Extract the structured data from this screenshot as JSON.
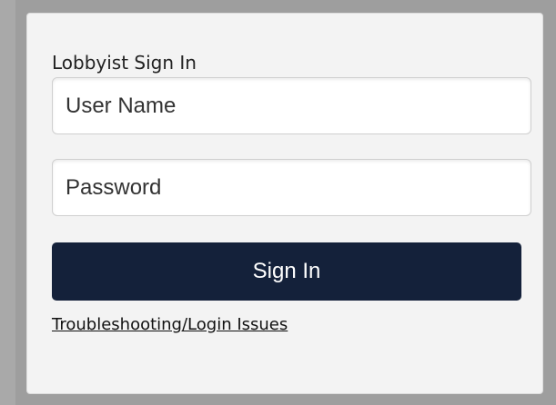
{
  "login": {
    "title": "Lobbyist Sign In",
    "username_placeholder": "User Name",
    "password_placeholder": "Password",
    "submit_label": "Sign In",
    "help_link": "Troubleshooting/Login Issues"
  },
  "colors": {
    "page_background": "#9e9e9e",
    "panel_background": "#f3f3f3",
    "button_background": "#14213a",
    "button_text": "#ffffff"
  }
}
